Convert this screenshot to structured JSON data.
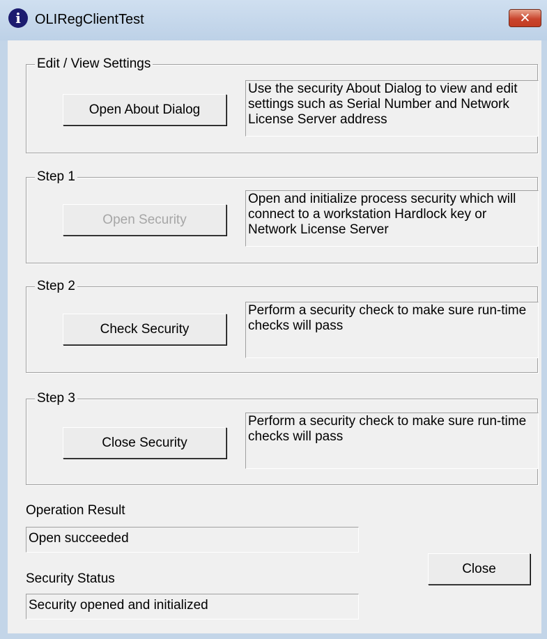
{
  "window": {
    "title": "OLIRegClientTest",
    "close_glyph": "✕",
    "icon": "info-icon"
  },
  "groups": [
    {
      "label": "Edit / View Settings",
      "button": "Open About Dialog",
      "button_enabled": true,
      "description": "Use the security About Dialog to view and edit settings such as Serial Number and Network License Server address"
    },
    {
      "label": "Step 1",
      "button": "Open Security",
      "button_enabled": false,
      "description": "Open and initialize process security which will connect to a workstation Hardlock key or Network License Server"
    },
    {
      "label": "Step 2",
      "button": "Check Security",
      "button_enabled": true,
      "description": "Perform a security check to make sure run-time checks will pass"
    },
    {
      "label": "Step 3",
      "button": "Close Security",
      "button_enabled": true,
      "description": "Perform a security check to make sure run-time checks will pass"
    }
  ],
  "operation_result": {
    "label": "Operation Result",
    "value": "Open succeeded"
  },
  "security_status": {
    "label": "Security Status",
    "value": "Security opened and initialized"
  },
  "close_button": "Close",
  "colors": {
    "frame": "#c3d5e8",
    "client": "#f0f0f0",
    "close_x": "#c9452d",
    "disabled_text": "#a6a6a6"
  }
}
